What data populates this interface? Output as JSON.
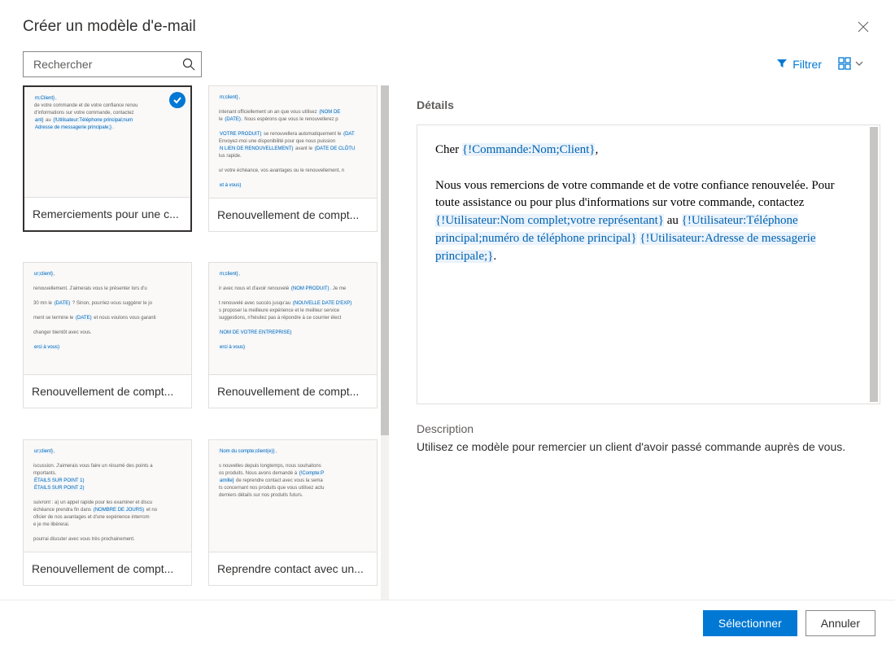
{
  "header": {
    "title": "Créer un modèle d'e-mail"
  },
  "toolbar": {
    "search_placeholder": "Rechercher",
    "filter_label": "Filtrer"
  },
  "templates": [
    {
      "name": "Remerciements pour une c..."
    },
    {
      "name": "Renouvellement de compt..."
    },
    {
      "name": "Renouvellement de compt..."
    },
    {
      "name": "Renouvellement de compt..."
    },
    {
      "name": "Renouvellement de compt..."
    },
    {
      "name": "Reprendre contact avec un..."
    }
  ],
  "details": {
    "label": "Détails",
    "preview_greeting_prefix": "Cher ",
    "preview_greeting_field": "{!Commande:Nom;Client}",
    "preview_greeting_suffix": ",",
    "preview_body_1": "Nous vous remercions de votre commande et de votre confiance renouvelée. Pour toute assistance ou pour plus d'informations sur votre commande, contactez ",
    "preview_field_2": "{!Utilisateur:Nom complet;votre représentant}",
    "preview_body_2": " au ",
    "preview_field_3": "{!Utilisateur:Téléphone principal;numéro de téléphone principal}",
    "preview_body_3": " ",
    "preview_field_4": "{!Utilisateur:Adresse de messagerie principale;}",
    "preview_body_4": ".",
    "description_label": "Description",
    "description_text": "Utilisez ce modèle pour remercier un client d'avoir passé commande auprès de vous."
  },
  "footer": {
    "select_label": "Sélectionner",
    "cancel_label": "Annuler"
  }
}
